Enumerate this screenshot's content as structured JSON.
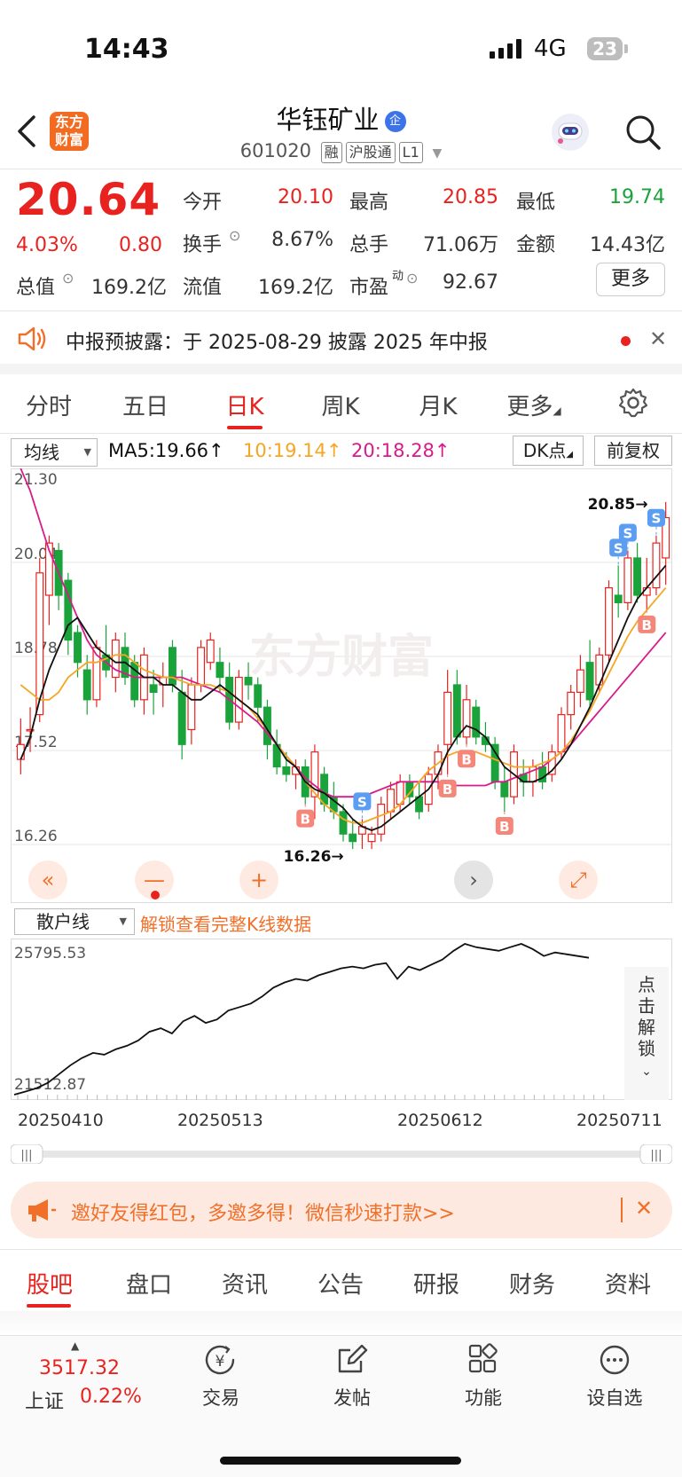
{
  "status": {
    "time": "14:43",
    "network": "4G",
    "battery": "23"
  },
  "header": {
    "logo": "东方财富",
    "name": "华钰矿业",
    "name_badge": "企",
    "code": "601020",
    "tags": [
      "融",
      "沪股通",
      "L1"
    ]
  },
  "quote": {
    "price": "20.64",
    "change_pct": "4.03%",
    "change": "0.80",
    "rows": [
      [
        {
          "label": "今开",
          "value": "20.10",
          "color": "#e8231f"
        },
        {
          "label": "最高",
          "value": "20.85",
          "color": "#e8231f"
        },
        {
          "label": "最低",
          "value": "19.74",
          "color": "#1aa33a"
        }
      ],
      [
        {
          "label": "换手",
          "value": "8.67%",
          "color": "#333333"
        },
        {
          "label": "总手",
          "value": "71.06万",
          "color": "#333333"
        },
        {
          "label": "金额",
          "value": "14.43亿",
          "color": "#333333"
        }
      ]
    ],
    "mktcap_label": "总值",
    "mktcap": "169.2亿",
    "float_label": "流值",
    "float_value": "169.2亿",
    "pe_label": "市盈",
    "pe_sup": "动",
    "pe_value": "92.67",
    "more": "更多"
  },
  "notice": {
    "text": "中报预披露：于 2025-08-29 披露 2025 年中报"
  },
  "period_tabs": [
    "分时",
    "五日",
    "日K",
    "周K",
    "月K",
    "更多"
  ],
  "ma": {
    "selector": "均线",
    "ma5": "MA5:19.66",
    "ma10": "10:19.14",
    "ma20": "20:18.28",
    "dk": "DK点",
    "fq": "前复权",
    "colors": {
      "ma5": "#111111",
      "ma10": "#f5a623",
      "ma20": "#d81b8a"
    }
  },
  "chart_data": {
    "type": "candlestick",
    "y_ticks": [
      "21.30",
      "20.04",
      "18.78",
      "17.52",
      "16.26"
    ],
    "ylim": [
      16.26,
      21.3
    ],
    "high_label": "20.85",
    "low_label": "16.26",
    "watermark": "东方财富",
    "grid": true,
    "candles": [
      [
        17.4,
        17.95,
        17.2,
        17.6
      ],
      [
        17.8,
        18.1,
        17.5,
        17.8
      ],
      [
        18.0,
        20.1,
        17.9,
        19.9
      ],
      [
        19.6,
        20.4,
        19.2,
        20.3
      ],
      [
        20.2,
        20.3,
        19.4,
        19.6
      ],
      [
        19.8,
        19.9,
        18.8,
        19.0
      ],
      [
        19.1,
        19.2,
        18.5,
        18.7
      ],
      [
        18.6,
        18.8,
        18.0,
        18.2
      ],
      [
        18.2,
        19.0,
        18.1,
        18.9
      ],
      [
        18.8,
        19.2,
        18.5,
        18.6
      ],
      [
        18.5,
        19.1,
        18.3,
        19.0
      ],
      [
        18.9,
        19.1,
        18.4,
        18.5
      ],
      [
        18.7,
        18.8,
        18.1,
        18.2
      ],
      [
        18.2,
        18.9,
        18.0,
        18.8
      ],
      [
        18.4,
        18.6,
        18.0,
        18.3
      ],
      [
        18.4,
        18.7,
        18.1,
        18.5
      ],
      [
        18.9,
        19.0,
        18.3,
        18.4
      ],
      [
        18.3,
        18.6,
        17.4,
        17.6
      ],
      [
        17.8,
        18.5,
        17.6,
        18.4
      ],
      [
        18.4,
        19.0,
        18.3,
        18.9
      ],
      [
        18.7,
        19.1,
        18.6,
        19.0
      ],
      [
        18.7,
        18.9,
        18.3,
        18.5
      ],
      [
        18.5,
        18.7,
        17.8,
        17.9
      ],
      [
        17.9,
        18.6,
        17.8,
        18.5
      ],
      [
        18.5,
        18.7,
        18.2,
        18.4
      ],
      [
        18.4,
        18.5,
        17.9,
        18.1
      ],
      [
        18.1,
        18.2,
        17.4,
        17.6
      ],
      [
        17.6,
        17.8,
        17.2,
        17.3
      ],
      [
        17.3,
        17.5,
        17.1,
        17.2
      ],
      [
        17.2,
        17.4,
        17.0,
        17.3
      ],
      [
        17.3,
        17.4,
        16.8,
        16.9
      ],
      [
        16.9,
        17.6,
        16.6,
        17.5
      ],
      [
        17.2,
        17.3,
        16.7,
        16.8
      ],
      [
        16.9,
        17.1,
        16.6,
        16.7
      ],
      [
        16.7,
        16.8,
        16.3,
        16.4
      ],
      [
        16.4,
        16.6,
        16.2,
        16.3
      ],
      [
        16.4,
        16.6,
        16.2,
        16.5
      ],
      [
        16.3,
        16.5,
        16.2,
        16.4
      ],
      [
        16.4,
        16.9,
        16.3,
        16.8
      ],
      [
        16.7,
        17.1,
        16.6,
        17.0
      ],
      [
        16.8,
        17.2,
        16.7,
        17.1
      ],
      [
        17.1,
        17.2,
        16.8,
        16.9
      ],
      [
        16.9,
        17.1,
        16.6,
        16.7
      ],
      [
        16.8,
        17.3,
        16.7,
        17.2
      ],
      [
        17.2,
        17.6,
        17.0,
        17.5
      ],
      [
        17.6,
        18.6,
        17.2,
        18.3
      ],
      [
        18.4,
        18.6,
        17.6,
        17.7
      ],
      [
        17.7,
        18.4,
        17.6,
        18.2
      ],
      [
        18.1,
        18.2,
        17.6,
        17.7
      ],
      [
        17.7,
        17.9,
        17.5,
        17.6
      ],
      [
        17.6,
        17.7,
        17.0,
        17.1
      ],
      [
        17.1,
        17.3,
        16.7,
        16.9
      ],
      [
        16.9,
        17.6,
        16.8,
        17.5
      ],
      [
        17.2,
        17.4,
        16.9,
        17.1
      ],
      [
        17.1,
        17.4,
        16.9,
        17.3
      ],
      [
        17.3,
        17.5,
        17.0,
        17.1
      ],
      [
        17.2,
        17.6,
        17.1,
        17.5
      ],
      [
        17.5,
        18.1,
        17.4,
        18.0
      ],
      [
        18.0,
        18.4,
        17.8,
        18.3
      ],
      [
        18.3,
        18.8,
        18.1,
        18.6
      ],
      [
        18.7,
        19.0,
        18.1,
        18.2
      ],
      [
        18.4,
        18.9,
        18.3,
        18.8
      ],
      [
        18.8,
        19.8,
        18.7,
        19.7
      ],
      [
        19.6,
        20.0,
        19.3,
        19.5
      ],
      [
        19.5,
        20.2,
        19.4,
        20.1
      ],
      [
        20.1,
        20.3,
        19.5,
        19.6
      ],
      [
        19.6,
        20.1,
        19.4,
        19.7
      ],
      [
        19.7,
        20.4,
        19.6,
        20.3
      ],
      [
        20.1,
        20.85,
        19.74,
        20.64
      ]
    ],
    "ma5": [
      17.4,
      17.7,
      18.2,
      18.6,
      18.9,
      19.2,
      19.3,
      19.1,
      18.9,
      18.8,
      18.7,
      18.7,
      18.6,
      18.5,
      18.5,
      18.4,
      18.4,
      18.3,
      18.2,
      18.2,
      18.3,
      18.4,
      18.3,
      18.2,
      18.1,
      18.0,
      17.8,
      17.6,
      17.4,
      17.3,
      17.1,
      17.0,
      16.95,
      16.85,
      16.75,
      16.6,
      16.5,
      16.45,
      16.5,
      16.6,
      16.7,
      16.8,
      16.9,
      17.0,
      17.2,
      17.5,
      17.7,
      17.85,
      17.8,
      17.7,
      17.5,
      17.3,
      17.2,
      17.1,
      17.1,
      17.15,
      17.25,
      17.4,
      17.6,
      17.85,
      18.1,
      18.4,
      18.7,
      19.0,
      19.3,
      19.55,
      19.7,
      19.85,
      20.0
    ],
    "ma10": [
      18.4,
      18.3,
      18.2,
      18.2,
      18.3,
      18.5,
      18.6,
      18.7,
      18.7,
      18.75,
      18.8,
      18.8,
      18.7,
      18.6,
      18.55,
      18.5,
      18.5,
      18.45,
      18.4,
      18.4,
      18.4,
      18.35,
      18.3,
      18.2,
      18.1,
      17.95,
      17.8,
      17.6,
      17.45,
      17.3,
      17.1,
      16.95,
      16.8,
      16.7,
      16.6,
      16.55,
      16.55,
      16.6,
      16.65,
      16.7,
      16.8,
      16.95,
      17.1,
      17.25,
      17.35,
      17.45,
      17.5,
      17.5,
      17.5,
      17.45,
      17.4,
      17.35,
      17.3,
      17.3,
      17.3,
      17.35,
      17.4,
      17.5,
      17.65,
      17.85,
      18.05,
      18.3,
      18.55,
      18.8,
      19.05,
      19.25,
      19.4,
      19.55,
      19.7
    ],
    "ma20": [
      21.3,
      21.0,
      20.6,
      20.2,
      19.9,
      19.6,
      19.3,
      19.0,
      18.8,
      18.7,
      18.6,
      18.55,
      18.5,
      18.5,
      18.5,
      18.5,
      18.5,
      18.5,
      18.45,
      18.4,
      18.35,
      18.3,
      18.2,
      18.1,
      18.0,
      17.9,
      17.75,
      17.6,
      17.45,
      17.3,
      17.15,
      17.05,
      16.95,
      16.9,
      16.9,
      16.9,
      16.9,
      16.95,
      17.0,
      17.05,
      17.1,
      17.1,
      17.1,
      17.1,
      17.1,
      17.05,
      17.05,
      17.05,
      17.05,
      17.05,
      17.1,
      17.1,
      17.15,
      17.2,
      17.25,
      17.3,
      17.4,
      17.5,
      17.6,
      17.75,
      17.9,
      18.05,
      18.2,
      18.35,
      18.5,
      18.65,
      18.8,
      18.95,
      19.1
    ],
    "signals": [
      {
        "i": 30,
        "type": "B"
      },
      {
        "i": 36,
        "type": "S"
      },
      {
        "i": 45,
        "type": "B"
      },
      {
        "i": 47,
        "type": "B"
      },
      {
        "i": 51,
        "type": "B"
      },
      {
        "i": 63,
        "type": "S"
      },
      {
        "i": 64,
        "type": "S"
      },
      {
        "i": 66,
        "type": "B"
      },
      {
        "i": 67,
        "type": "S"
      }
    ]
  },
  "retail": {
    "selector": "散户线",
    "unlock_text": "解锁查看完整K线数据",
    "y_ticks": [
      "25795.53",
      "21512.87"
    ],
    "ylim": [
      21512.87,
      25795.53
    ],
    "side_text": "点击解锁",
    "values": [
      21512.87,
      21600,
      21700,
      21850,
      22100,
      22350,
      22550,
      22700,
      22650,
      22800,
      22900,
      23050,
      23300,
      23400,
      23250,
      23600,
      23750,
      23550,
      23650,
      23900,
      24000,
      24100,
      24300,
      24550,
      24700,
      24800,
      24750,
      24900,
      25000,
      25100,
      25150,
      25100,
      25200,
      25250,
      24800,
      25150,
      25050,
      25200,
      25350,
      25600,
      25795.53,
      25700,
      25650,
      25600,
      25700,
      25795,
      25650,
      25450,
      25550,
      25500,
      25450,
      25400
    ],
    "dates": [
      "20250410",
      "20250513",
      "20250612",
      "20250711"
    ]
  },
  "banner": {
    "text": "邀好友得红包，多邀多得！微信秒速打款>>"
  },
  "bottom_tabs": [
    "股吧",
    "盘口",
    "资讯",
    "公告",
    "研报",
    "财务",
    "资料"
  ],
  "bottombar": {
    "index_value": "3517.32",
    "index_name": "上证",
    "index_pct": "0.22%",
    "items": [
      {
        "label": "交易",
        "icon": "yen-icon"
      },
      {
        "label": "发帖",
        "icon": "edit-icon"
      },
      {
        "label": "功能",
        "icon": "grid-icon"
      },
      {
        "label": "设自选",
        "icon": "dots-icon"
      }
    ]
  }
}
